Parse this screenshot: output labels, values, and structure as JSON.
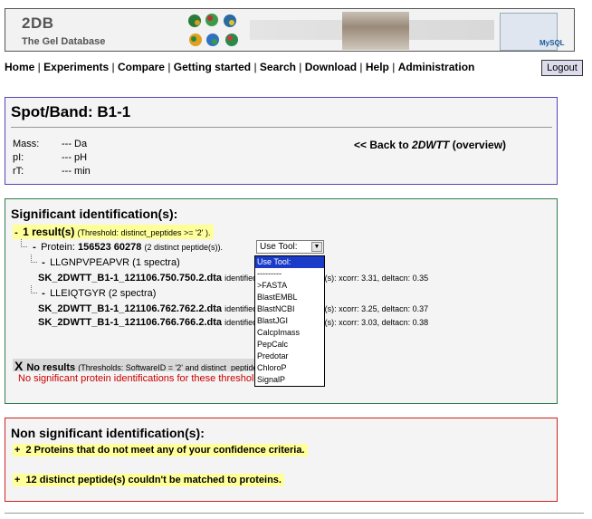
{
  "banner": {
    "title": "2DB",
    "subtitle": "The Gel Database",
    "db_logo": "MySQL"
  },
  "nav": {
    "items": [
      "Home",
      "Experiments",
      "Compare",
      "Getting started",
      "Search",
      "Download",
      "Help",
      "Administration"
    ],
    "separator": " | "
  },
  "logout_label": "Logout",
  "spot": {
    "title": "Spot/Band: B1-1",
    "props": [
      {
        "label": "Mass:",
        "value": "--- Da"
      },
      {
        "label": "pI:",
        "value": "--- pH"
      },
      {
        "label": "rT:",
        "value": "--- min"
      }
    ],
    "back_prefix": "<< Back to ",
    "back_target": "2DWTT",
    "back_suffix": " (overview)"
  },
  "significant": {
    "title": "Significant identification(s):",
    "toggle": "-",
    "result_count": "1 result(s)",
    "threshold": "(Threshold: distinct_peptides >= '2' ).",
    "protein_label": "Protein:",
    "protein_id": "156523 60278",
    "protein_note": "(2 distinct peptide(s)).",
    "peptides": [
      {
        "seq": "LLGNPVPEAPVR (1 spectra)",
        "spectra": [
          {
            "file": "SK_2DWTT_B1-1_121106.750.750.2.dta",
            "detail": "identified as best with score(s): xcorr: 3.31, deltacn: 0.35"
          }
        ]
      },
      {
        "seq": "LLEIQTGYR (2 spectra)",
        "spectra": [
          {
            "file": "SK_2DWTT_B1-1_121106.762.762.2.dta",
            "detail": "identified as best with score(s): xcorr: 3.25, deltacn: 0.37"
          },
          {
            "file": "SK_2DWTT_B1-1_121106.766.766.2.dta",
            "detail": "identified as best with score(s): xcorr: 3.03, deltacn: 0.38"
          }
        ]
      }
    ],
    "no_results_icon": "X",
    "no_results_label": "No results",
    "no_results_threshold": "(Thresholds: SoftwareID = '2' and distinct_peptides >= '2').",
    "no_results_msg": "No significant protein identifications for these thresholds."
  },
  "tool_select": {
    "value": "Use Tool:",
    "options": [
      "Use Tool:",
      "---------",
      ">FASTA",
      "BlastEMBL",
      "BlastNCBI",
      "BlastJGI",
      "CalcpImass",
      "PepCalc",
      "Predotar",
      "ChloroP",
      "SignalP"
    ],
    "selected_index": 0
  },
  "non_significant": {
    "title": "Non significant identification(s):",
    "rows": [
      {
        "icon": "+",
        "text": "2 Proteins that do not meet any of your confidence criteria."
      },
      {
        "icon": "+",
        "text": "12 distinct peptide(s) couldn't be matched to proteins."
      }
    ]
  },
  "colors": {
    "spot_border": "#5544bb",
    "sig_border": "#2e7d4e",
    "nonsig_border": "#cc2222",
    "highlight": "#ffff99",
    "alert_text": "#cc0000",
    "select_highlight": "#1a3cc8"
  }
}
